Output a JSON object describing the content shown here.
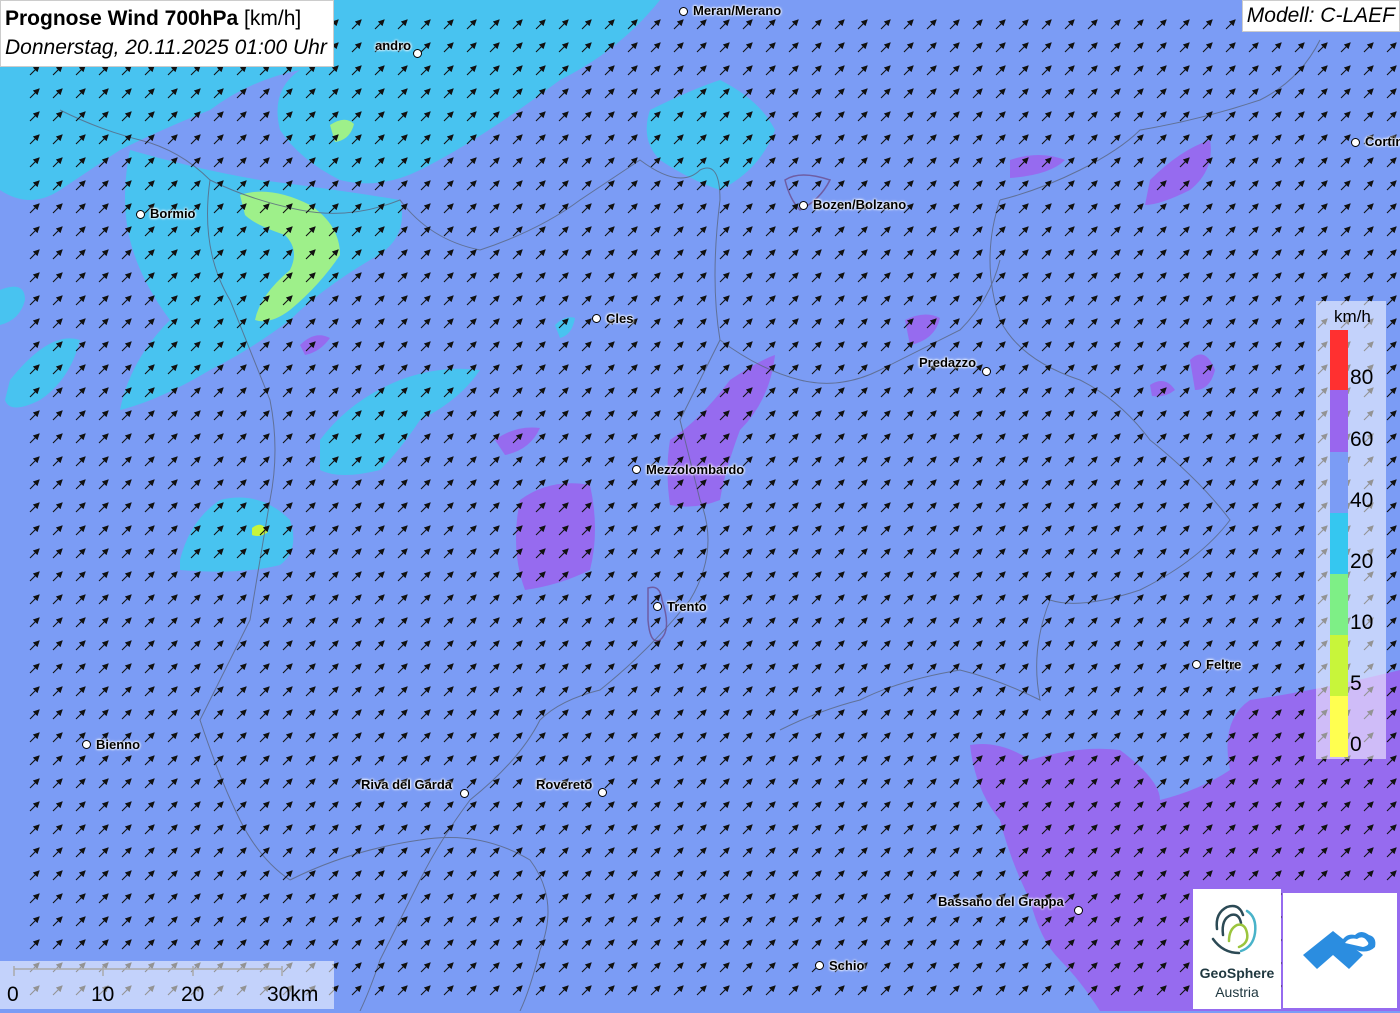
{
  "title": {
    "main": "Prognose Wind 700hPa",
    "unit": "[km/h]",
    "date": "Donnerstag, 20.11.2025 01:00 Uhr"
  },
  "model": "Modell: C-LAEF",
  "cities": [
    {
      "name": "Meran/Merano"
    },
    {
      "name": "andro"
    },
    {
      "name": "Cortin"
    },
    {
      "name": "Bormio"
    },
    {
      "name": "Bozen/Bolzano"
    },
    {
      "name": "Cles"
    },
    {
      "name": "Predazzo"
    },
    {
      "name": "Mezzolombardo"
    },
    {
      "name": "Trento"
    },
    {
      "name": "Feltre"
    },
    {
      "name": "Bienno"
    },
    {
      "name": "Riva del Garda"
    },
    {
      "name": "Rovereto"
    },
    {
      "name": "Bassano del Grappa"
    },
    {
      "name": "Schio"
    }
  ],
  "legend": {
    "unit": "km/h",
    "labels": [
      "80",
      "60",
      "40",
      "20",
      "10",
      "5",
      "0"
    ],
    "colors": [
      "#ff3030",
      "#9966ee",
      "#7b9cf5",
      "#35c7f0",
      "#7eef86",
      "#c8f53a",
      "#ffff50"
    ]
  },
  "scale_bar": {
    "labels": [
      "0",
      "10",
      "20",
      "30km"
    ]
  },
  "logos": {
    "geosphere_line1": "GeoSphere",
    "geosphere_line2": "Austria",
    "app_icon": "cloud-house-icon"
  },
  "colors": {
    "base_wind": "#7b9cf5",
    "cyan_zone": "#43c8f0",
    "violet_zone": "#9966ee",
    "green_zone": "#9ef08a"
  }
}
